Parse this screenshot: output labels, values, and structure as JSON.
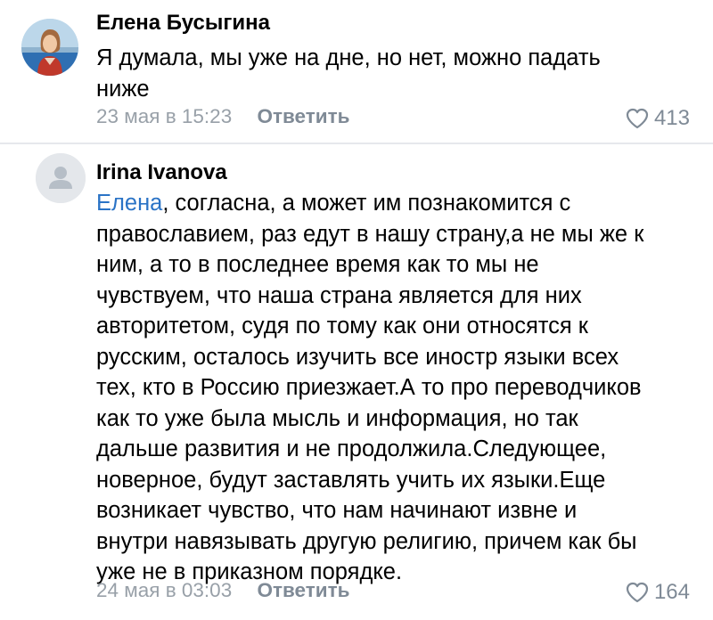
{
  "comments": [
    {
      "author": "Елена Бусыгина",
      "avatar": "photo-avatar",
      "text_lines": [
        "Я думала, мы уже на дне, но нет, можно падать",
        "ниже"
      ],
      "date": "23 мая в 15:23",
      "reply_label": "Ответить",
      "likes": "413"
    },
    {
      "author": "Irina Ivanova",
      "avatar": "placeholder-user-icon",
      "mention": "Елена",
      "first_line_rest": ", согласна, а может им познакомится с",
      "text_lines": [
        "православием, раз едут в нашу страну,а не мы же к",
        "ним, а то в последнее время как то мы не",
        "чувствуем, что наша страна является для  них",
        "авторитетом, судя по тому как они относятся к",
        "русским, осталось изучить все иностр языки  всех",
        "тех, кто в Россию приезжает.А то про переводчиков",
        "как то уже была мысль и информация, но так",
        "дальше развития и не продолжила.Следующее,",
        "новерное, будут заставлять учить их языки.Еще",
        "возникает чувство, что нам начинают извне и",
        "внутри навязывать другую религию, причем как бы",
        "уже не в приказном порядке."
      ],
      "date": "24 мая в 03:03",
      "reply_label": "Ответить",
      "likes": "164"
    }
  ],
  "colors": {
    "mention": "#2a73c6",
    "meta": "#98a0a8",
    "reply": "#7f8a96",
    "divider": "#e6e8ec"
  }
}
